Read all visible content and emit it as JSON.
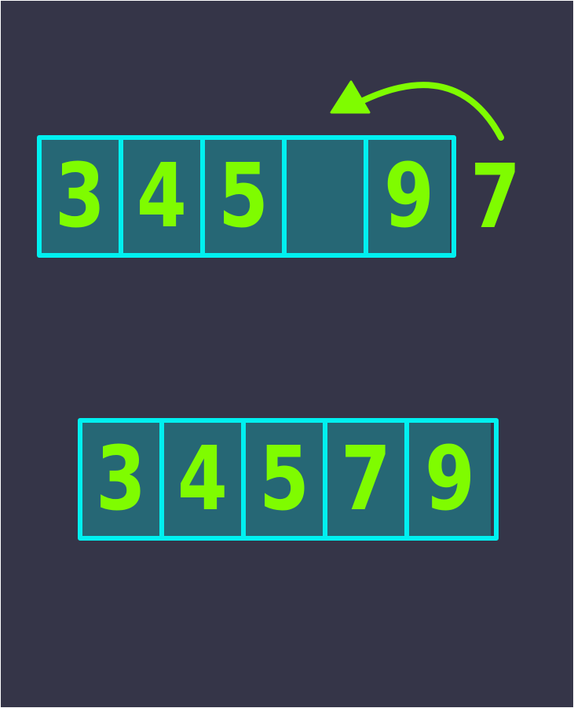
{
  "before": {
    "cells": [
      "3",
      "4",
      "5",
      "",
      "9"
    ],
    "incoming": "7"
  },
  "after": {
    "cells": [
      "3",
      "4",
      "5",
      "7",
      "9"
    ]
  },
  "colors": {
    "background": "#353548",
    "cell_fill": "#266775",
    "cell_border": "#00f0f0",
    "digit": "#7ffc00",
    "arrow": "#7ffc00"
  }
}
